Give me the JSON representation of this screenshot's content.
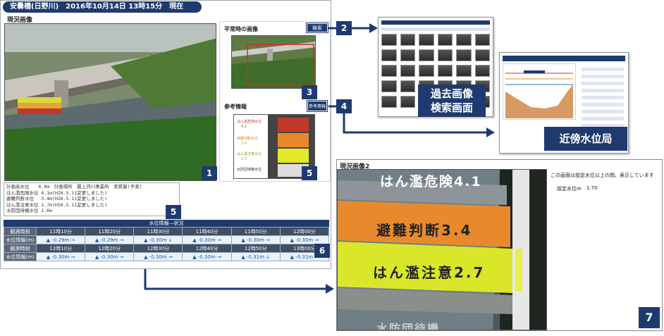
{
  "main_window": {
    "title": "安曇橋(日野川)　2016年10月14日 13時15分　現在",
    "current_image_label": "現況画像",
    "normal_image_label": "平常時の画像",
    "search_button": "検索",
    "reference_label": "参考情報",
    "reference_button": "参考情報",
    "badges": [
      "1",
      "2",
      "3",
      "4",
      "5",
      "5",
      "6",
      "7"
    ],
    "levels": [
      "計画高水位　　6.0m　計画場所　最上河川事業所　実質量(予測)",
      "はん濫危険水位 4.1m(H28.5.11変更しました)",
      "避難判断水位　 3.4m(H28.5.11変更しました)",
      "はん濫注意水位 2.7m(H28.5.11変更しました)",
      "水防団待機水位 1.6m"
    ],
    "gauge_sign_labels": [
      "はん濫危険水位",
      "4.1",
      "避難判断水位",
      "3.4",
      "はん濫注意水位",
      "2.7",
      "水防団待機水位"
    ]
  },
  "water_table": {
    "caption": "水位情報―状況",
    "rows": [
      {
        "label": "観測時刻",
        "cells": [
          "11時10分",
          "11時20分",
          "11時30分",
          "11時40分",
          "11時50分",
          "12時00分"
        ]
      },
      {
        "label": "水位情報(m)",
        "cells": [
          "▲ -0.29m →",
          "▲ -0.29m →",
          "▲ -0.30m ↓",
          "▲ -0.30m →",
          "▲ -0.30m →",
          "▲ -0.30m →"
        ]
      },
      {
        "label": "観測時刻",
        "cells": [
          "12時10分",
          "12時20分",
          "12時30分",
          "12時40分",
          "12時50分",
          "13時00分"
        ]
      },
      {
        "label": "水位情報(m)",
        "cells": [
          "▲ -0.30m →",
          "▲ -0.30m →",
          "▲ -0.30m →",
          "▲ -0.30m →",
          "▲ -0.31m ↓",
          "▲ -0.31m →"
        ]
      }
    ]
  },
  "callouts": {
    "past_image_search": [
      "過去画像",
      "検索画面"
    ],
    "nearby_station": "近傍水位局"
  },
  "current_image_2": {
    "title": "現況画像2",
    "notice": "この画面は設定水位以上の間、表示しています",
    "setting_label": "設定水位m",
    "setting_value": "1.70",
    "sign_labels": [
      "はん濫危険4.1",
      "避難判断3.4",
      "はん濫注意2.7",
      "水防団待機"
    ]
  },
  "colors": {
    "navy": "#1f3a6e",
    "orange": "#e88a2c",
    "yellow": "#e2e82a",
    "gray": "#8a8a8a"
  }
}
